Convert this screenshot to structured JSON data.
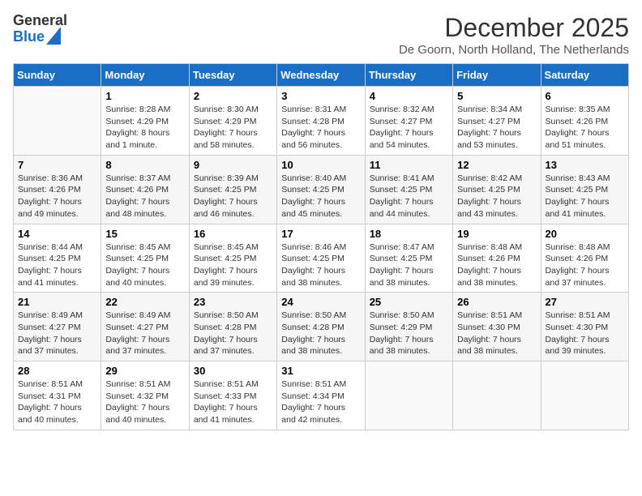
{
  "header": {
    "logo_general": "General",
    "logo_blue": "Blue",
    "month_title": "December 2025",
    "location": "De Goorn, North Holland, The Netherlands"
  },
  "days_of_week": [
    "Sunday",
    "Monday",
    "Tuesday",
    "Wednesday",
    "Thursday",
    "Friday",
    "Saturday"
  ],
  "weeks": [
    [
      {
        "day": "",
        "info": ""
      },
      {
        "day": "1",
        "info": "Sunrise: 8:28 AM\nSunset: 4:29 PM\nDaylight: 8 hours\nand 1 minute."
      },
      {
        "day": "2",
        "info": "Sunrise: 8:30 AM\nSunset: 4:29 PM\nDaylight: 7 hours\nand 58 minutes."
      },
      {
        "day": "3",
        "info": "Sunrise: 8:31 AM\nSunset: 4:28 PM\nDaylight: 7 hours\nand 56 minutes."
      },
      {
        "day": "4",
        "info": "Sunrise: 8:32 AM\nSunset: 4:27 PM\nDaylight: 7 hours\nand 54 minutes."
      },
      {
        "day": "5",
        "info": "Sunrise: 8:34 AM\nSunset: 4:27 PM\nDaylight: 7 hours\nand 53 minutes."
      },
      {
        "day": "6",
        "info": "Sunrise: 8:35 AM\nSunset: 4:26 PM\nDaylight: 7 hours\nand 51 minutes."
      }
    ],
    [
      {
        "day": "7",
        "info": "Sunrise: 8:36 AM\nSunset: 4:26 PM\nDaylight: 7 hours\nand 49 minutes."
      },
      {
        "day": "8",
        "info": "Sunrise: 8:37 AM\nSunset: 4:26 PM\nDaylight: 7 hours\nand 48 minutes."
      },
      {
        "day": "9",
        "info": "Sunrise: 8:39 AM\nSunset: 4:25 PM\nDaylight: 7 hours\nand 46 minutes."
      },
      {
        "day": "10",
        "info": "Sunrise: 8:40 AM\nSunset: 4:25 PM\nDaylight: 7 hours\nand 45 minutes."
      },
      {
        "day": "11",
        "info": "Sunrise: 8:41 AM\nSunset: 4:25 PM\nDaylight: 7 hours\nand 44 minutes."
      },
      {
        "day": "12",
        "info": "Sunrise: 8:42 AM\nSunset: 4:25 PM\nDaylight: 7 hours\nand 43 minutes."
      },
      {
        "day": "13",
        "info": "Sunrise: 8:43 AM\nSunset: 4:25 PM\nDaylight: 7 hours\nand 41 minutes."
      }
    ],
    [
      {
        "day": "14",
        "info": "Sunrise: 8:44 AM\nSunset: 4:25 PM\nDaylight: 7 hours\nand 41 minutes."
      },
      {
        "day": "15",
        "info": "Sunrise: 8:45 AM\nSunset: 4:25 PM\nDaylight: 7 hours\nand 40 minutes."
      },
      {
        "day": "16",
        "info": "Sunrise: 8:45 AM\nSunset: 4:25 PM\nDaylight: 7 hours\nand 39 minutes."
      },
      {
        "day": "17",
        "info": "Sunrise: 8:46 AM\nSunset: 4:25 PM\nDaylight: 7 hours\nand 38 minutes."
      },
      {
        "day": "18",
        "info": "Sunrise: 8:47 AM\nSunset: 4:25 PM\nDaylight: 7 hours\nand 38 minutes."
      },
      {
        "day": "19",
        "info": "Sunrise: 8:48 AM\nSunset: 4:26 PM\nDaylight: 7 hours\nand 38 minutes."
      },
      {
        "day": "20",
        "info": "Sunrise: 8:48 AM\nSunset: 4:26 PM\nDaylight: 7 hours\nand 37 minutes."
      }
    ],
    [
      {
        "day": "21",
        "info": "Sunrise: 8:49 AM\nSunset: 4:27 PM\nDaylight: 7 hours\nand 37 minutes."
      },
      {
        "day": "22",
        "info": "Sunrise: 8:49 AM\nSunset: 4:27 PM\nDaylight: 7 hours\nand 37 minutes."
      },
      {
        "day": "23",
        "info": "Sunrise: 8:50 AM\nSunset: 4:28 PM\nDaylight: 7 hours\nand 37 minutes."
      },
      {
        "day": "24",
        "info": "Sunrise: 8:50 AM\nSunset: 4:28 PM\nDaylight: 7 hours\nand 38 minutes."
      },
      {
        "day": "25",
        "info": "Sunrise: 8:50 AM\nSunset: 4:29 PM\nDaylight: 7 hours\nand 38 minutes."
      },
      {
        "day": "26",
        "info": "Sunrise: 8:51 AM\nSunset: 4:30 PM\nDaylight: 7 hours\nand 38 minutes."
      },
      {
        "day": "27",
        "info": "Sunrise: 8:51 AM\nSunset: 4:30 PM\nDaylight: 7 hours\nand 39 minutes."
      }
    ],
    [
      {
        "day": "28",
        "info": "Sunrise: 8:51 AM\nSunset: 4:31 PM\nDaylight: 7 hours\nand 40 minutes."
      },
      {
        "day": "29",
        "info": "Sunrise: 8:51 AM\nSunset: 4:32 PM\nDaylight: 7 hours\nand 40 minutes."
      },
      {
        "day": "30",
        "info": "Sunrise: 8:51 AM\nSunset: 4:33 PM\nDaylight: 7 hours\nand 41 minutes."
      },
      {
        "day": "31",
        "info": "Sunrise: 8:51 AM\nSunset: 4:34 PM\nDaylight: 7 hours\nand 42 minutes."
      },
      {
        "day": "",
        "info": ""
      },
      {
        "day": "",
        "info": ""
      },
      {
        "day": "",
        "info": ""
      }
    ]
  ]
}
